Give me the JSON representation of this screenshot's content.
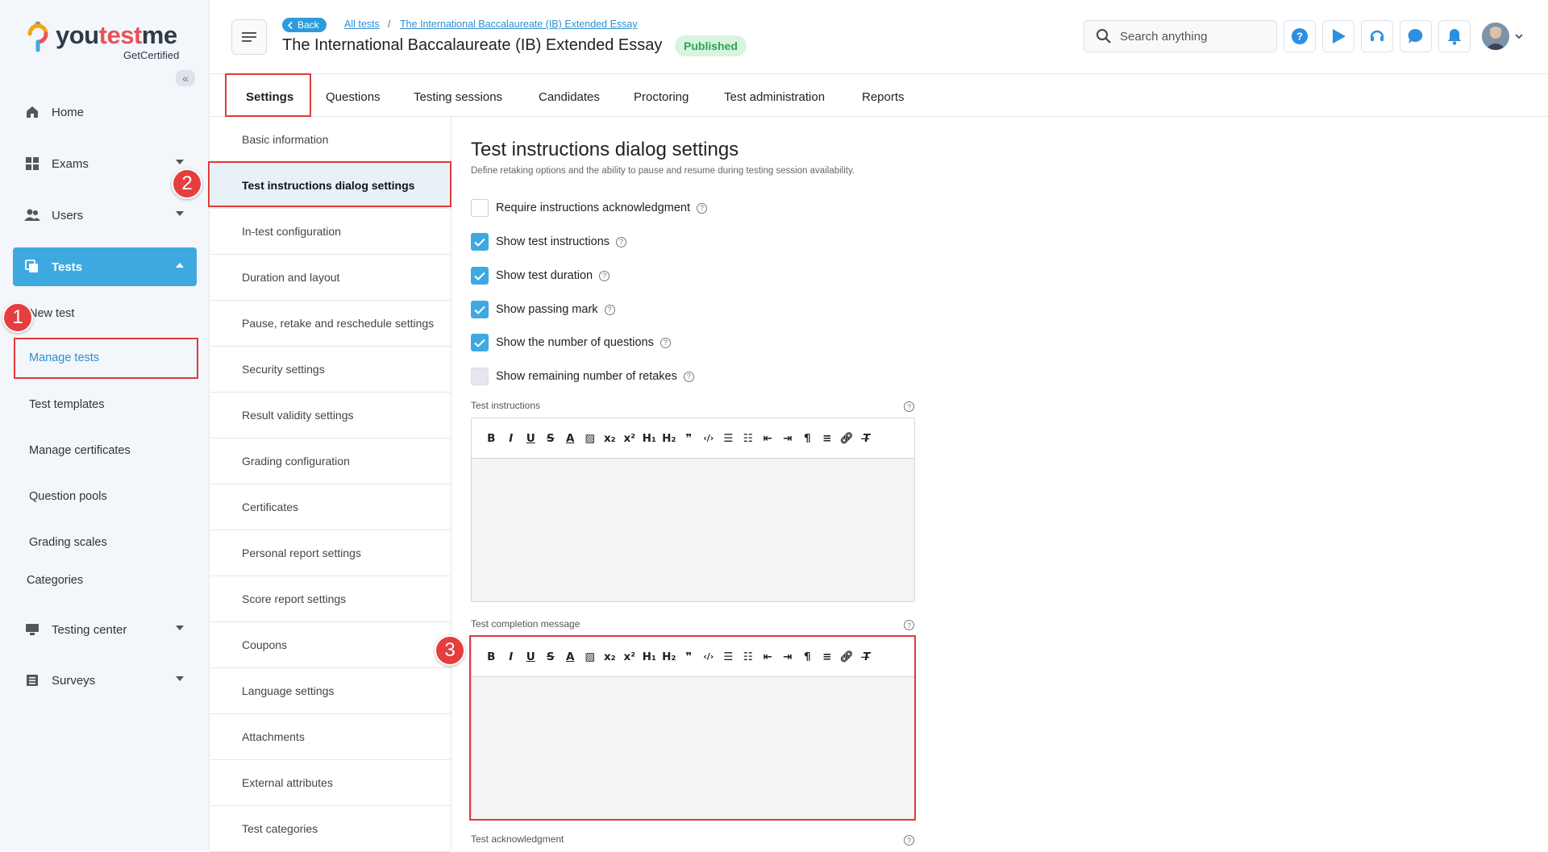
{
  "brand": {
    "name_prefix": "you",
    "name_highlight": "test",
    "name_suffix": "me",
    "tagline": "GetCertified"
  },
  "sidebar": {
    "nav": [
      {
        "label": "Home",
        "icon": "home-icon"
      },
      {
        "label": "Exams",
        "icon": "exams-icon"
      },
      {
        "label": "Users",
        "icon": "users-icon"
      },
      {
        "label": "Tests",
        "icon": "tests-icon"
      },
      {
        "label": "Testing center",
        "icon": "monitor-icon"
      },
      {
        "label": "Surveys",
        "icon": "surveys-icon"
      }
    ],
    "tests_sub": [
      "New test",
      "Manage tests",
      "Test templates",
      "Manage certificates",
      "Question pools",
      "Grading scales",
      "Categories"
    ]
  },
  "header": {
    "back_label": "Back",
    "breadcrumbs": [
      "All tests",
      "The International Baccalaureate (IB) Extended Essay"
    ],
    "breadcrumb_sep": "/",
    "title": "The International Baccalaureate (IB) Extended Essay",
    "status": "Published",
    "search_placeholder": "Search anything"
  },
  "tabs": [
    "Settings",
    "Questions",
    "Testing sessions",
    "Candidates",
    "Proctoring",
    "Test administration",
    "Reports"
  ],
  "settings_menu": [
    "Basic information",
    "Test instructions dialog settings",
    "In-test configuration",
    "Duration and layout",
    "Pause, retake and reschedule settings",
    "Security settings",
    "Result validity settings",
    "Grading configuration",
    "Certificates",
    "Personal report settings",
    "Score report settings",
    "Coupons",
    "Language settings",
    "Attachments",
    "External attributes",
    "Test categories"
  ],
  "main": {
    "title": "Test instructions dialog settings",
    "subtitle": "Define retaking options and the ability to pause and resume during testing session availability.",
    "options": [
      {
        "label": "Require instructions acknowledgment",
        "checked": false
      },
      {
        "label": "Show test instructions",
        "checked": true
      },
      {
        "label": "Show test duration",
        "checked": true
      },
      {
        "label": "Show passing mark",
        "checked": true
      },
      {
        "label": "Show the number of questions",
        "checked": true
      },
      {
        "label": "Show remaining number of retakes",
        "checked": false,
        "disabled": true
      }
    ],
    "fields": [
      "Test instructions",
      "Test completion message",
      "Test acknowledgment"
    ]
  },
  "annotations": [
    "1",
    "2",
    "3"
  ],
  "colors": {
    "accent": "#3ea9e0",
    "highlight_box": "#e03a3a",
    "published_bg": "#d8f3df",
    "published_text": "#2ea356"
  }
}
